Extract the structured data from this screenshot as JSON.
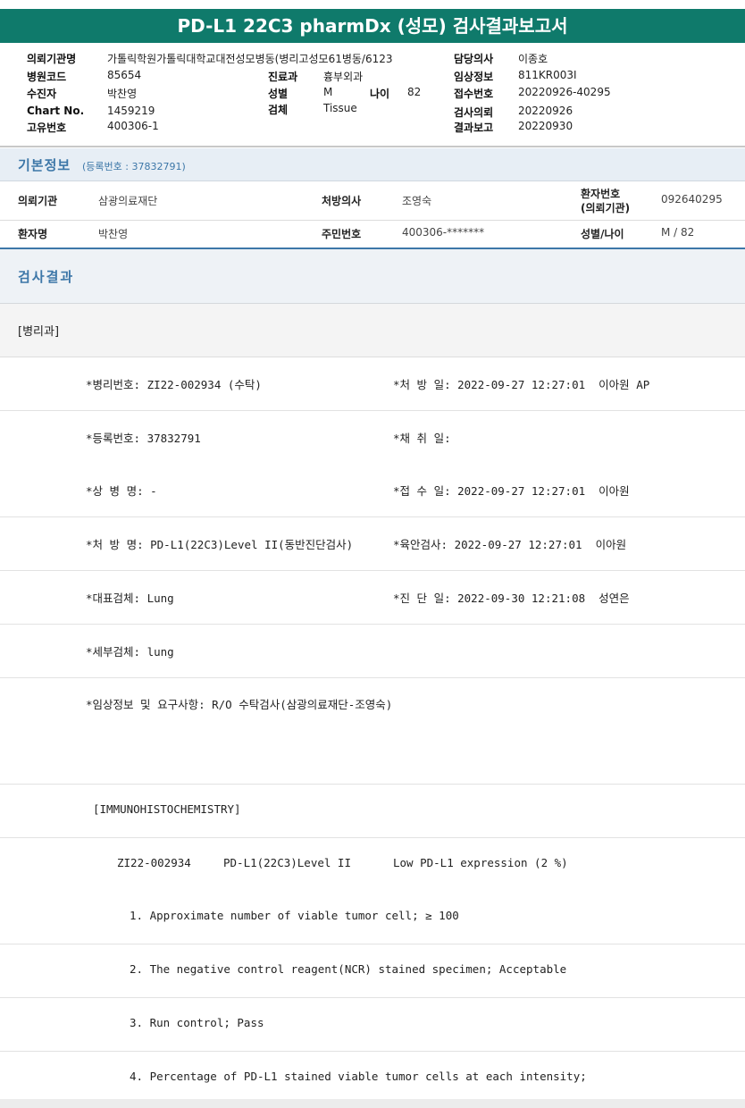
{
  "title": "PD-L1 22C3 pharmDx (성모) 검사결과보고서",
  "header": {
    "req_org_label": "의뢰기관명",
    "req_org_value": "가톨릭학원가톨릭대학교대전성모병동(병리고성모61병동/6123",
    "hosp_code_label": "병원코드",
    "hosp_code_value": "85654",
    "patient_label": "수진자",
    "patient_value": "박찬영",
    "chart_label": "Chart No.",
    "chart_value": "1459219",
    "unique_label": "고유번호",
    "unique_value": "400306-1",
    "dept_label": "진료과",
    "dept_value": "흉부외과",
    "sex_label": "성별",
    "sex_value": "M",
    "age_label": "나이",
    "age_value": "82",
    "specimen_label": "검체",
    "specimen_value": "Tissue",
    "doctor_label": "담당의사",
    "doctor_value": "이종호",
    "clinical_label": "임상정보",
    "clinical_value": "811KR003I",
    "receipt_label": "접수번호",
    "receipt_value": "20220926-40295",
    "request_label": "검사의뢰",
    "request_value": "20220926",
    "report_label": "결과보고",
    "report_value": "20220930"
  },
  "basic": {
    "title": "기본정보",
    "reg_no": "(등록번호 : 37832791)",
    "row1": {
      "org_label": "의뢰기관",
      "org_value": "삼광의료재단",
      "doc_label": "처방의사",
      "doc_value": "조영숙",
      "pno_label1": "환자번호",
      "pno_label2": "(의뢰기관)",
      "pno_value": "092640295"
    },
    "row2": {
      "name_label": "환자명",
      "name_value": "박찬영",
      "rrn_label": "주민번호",
      "rrn_value": "400306-*******",
      "sexage_label": "성별/나이",
      "sexage_value": "M / 82"
    }
  },
  "result": {
    "title": "검사결과",
    "dept": "[병리과]",
    "lines": {
      "l1a": "*병리번호: ZI22-002934 (수탁)",
      "l1b": "*처 방 일: 2022-09-27 12:27:01  이아원 AP",
      "l2a": "*등록번호: 37832791",
      "l2b": "*채 취 일:",
      "l3a": "*상 병 명: -",
      "l3b": "*접 수 일: 2022-09-27 12:27:01  이아원",
      "l4a": "*처 방 명: PD-L1(22C3)Level II(동반진단검사)",
      "l4b": "*육안검사: 2022-09-27 12:27:01  이아원",
      "l5a": "*대표검체: Lung",
      "l5b": "*진 단 일: 2022-09-30 12:21:08  성연은",
      "l6a": "*세부검체: lung",
      "l7a": "*임상정보 및 요구사항: R/O 수탁검사(삼광의료재단-조영숙)",
      "ihc": "[IMMUNOHISTOCHEMISTRY]",
      "ihc_id": "ZI22-002934",
      "ihc_test": "PD-L1(22C3)Level II",
      "ihc_result": "Low PD-L1 expression (2 %)",
      "item1": "1. Approximate number of viable tumor cell; ≥ 100",
      "item2": "2. The negative control reagent(NCR) stained specimen; Acceptable",
      "item3": "3. Run control; Pass",
      "item4": "4. Percentage of PD-L1 stained viable tumor cells at each intensity;"
    }
  }
}
